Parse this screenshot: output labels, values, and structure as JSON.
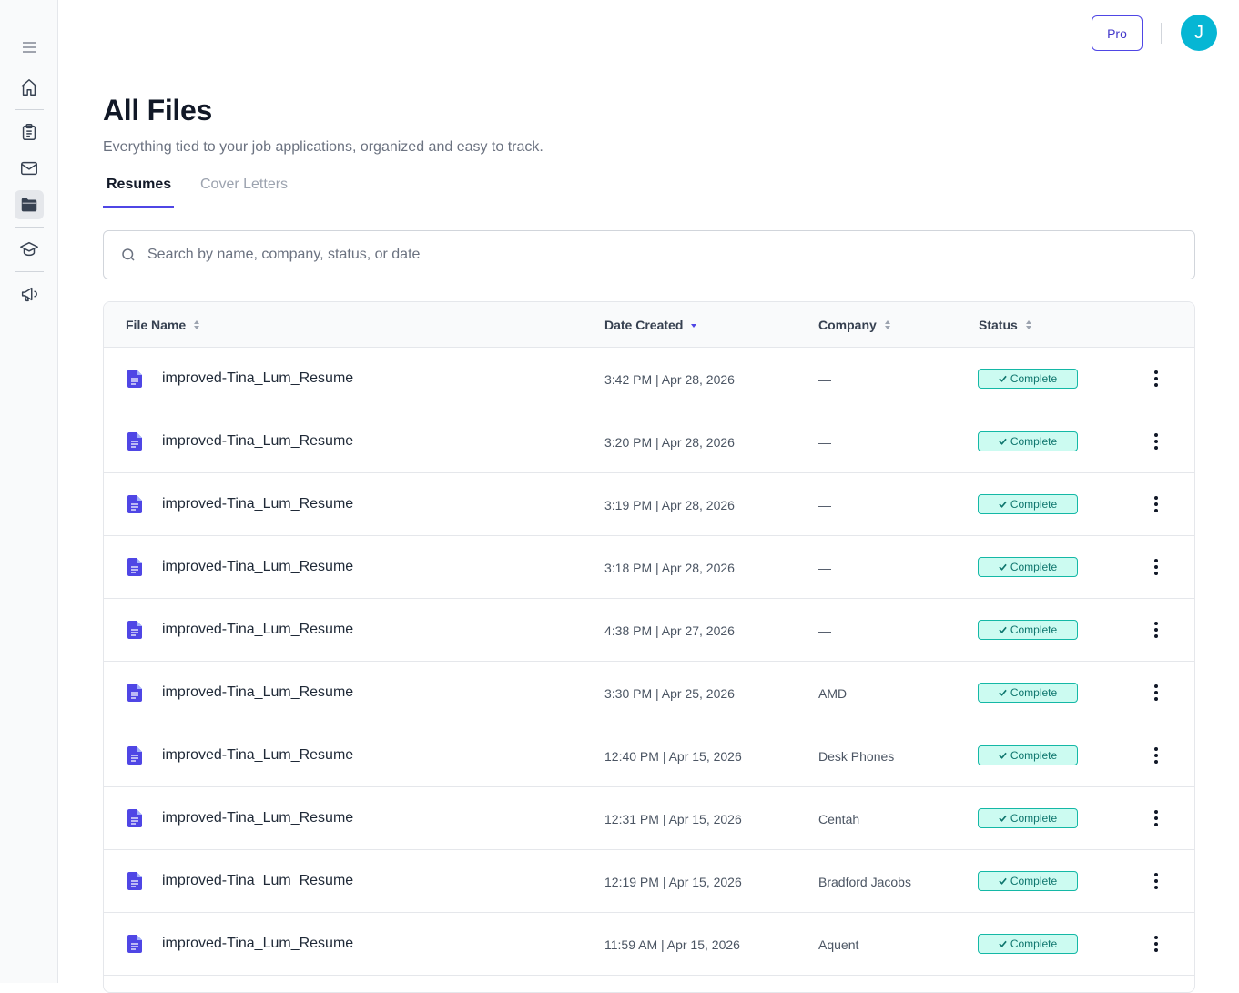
{
  "header": {
    "pro_label": "Pro",
    "avatar_initial": "J"
  },
  "page": {
    "title": "All Files",
    "subtitle": "Everything tied to your job applications, organized and easy to track."
  },
  "tabs": [
    {
      "label": "Resumes",
      "active": true
    },
    {
      "label": "Cover Letters",
      "active": false
    }
  ],
  "search": {
    "placeholder": "Search by name, company, status, or date",
    "value": ""
  },
  "table": {
    "columns": [
      "File Name",
      "Date Created",
      "Company",
      "Status"
    ],
    "sorted_column": "Date Created",
    "rows": [
      {
        "name": "improved-Tina_Lum_Resume",
        "date": "3:42 PM | Apr 28, 2026",
        "company": "—",
        "status": "Complete"
      },
      {
        "name": "improved-Tina_Lum_Resume",
        "date": "3:20 PM | Apr 28, 2026",
        "company": "—",
        "status": "Complete"
      },
      {
        "name": "improved-Tina_Lum_Resume",
        "date": "3:19 PM | Apr 28, 2026",
        "company": "—",
        "status": "Complete"
      },
      {
        "name": "improved-Tina_Lum_Resume",
        "date": "3:18 PM | Apr 28, 2026",
        "company": "—",
        "status": "Complete"
      },
      {
        "name": "improved-Tina_Lum_Resume",
        "date": "4:38 PM | Apr 27, 2026",
        "company": "—",
        "status": "Complete"
      },
      {
        "name": "improved-Tina_Lum_Resume",
        "date": "3:30 PM | Apr 25, 2026",
        "company": "AMD",
        "status": "Complete"
      },
      {
        "name": "improved-Tina_Lum_Resume",
        "date": "12:40 PM | Apr 15, 2026",
        "company": "Desk Phones",
        "status": "Complete"
      },
      {
        "name": "improved-Tina_Lum_Resume",
        "date": "12:31 PM | Apr 15, 2026",
        "company": "Centah",
        "status": "Complete"
      },
      {
        "name": "improved-Tina_Lum_Resume",
        "date": "12:19 PM | Apr 15, 2026",
        "company": "Bradford Jacobs",
        "status": "Complete"
      },
      {
        "name": "improved-Tina_Lum_Resume",
        "date": "11:59 AM | Apr 15, 2026",
        "company": "Aquent",
        "status": "Complete"
      }
    ]
  },
  "colors": {
    "accent": "#4f46e5",
    "avatar_bg": "#06b6d4",
    "status_complete": "#14b8a6"
  },
  "sidebar_icons": [
    "menu-icon",
    "home-icon",
    "clipboard-icon",
    "mail-icon",
    "folder-icon",
    "graduation-cap-icon",
    "megaphone-icon"
  ]
}
